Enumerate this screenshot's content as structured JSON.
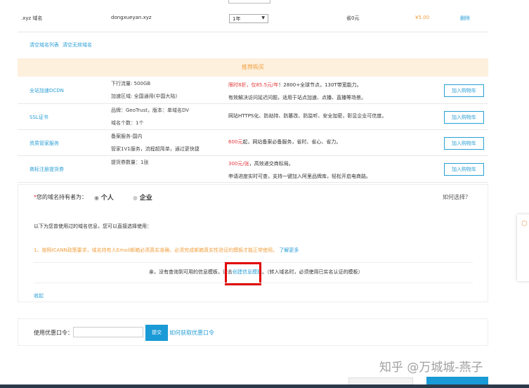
{
  "domain_row": {
    "type": ".xyz 域名",
    "name": "dongxueyan.xyz",
    "period": "1年",
    "discount": "省0元",
    "price": "¥5.00",
    "delete": "删除"
  },
  "list_links": [
    "清空域名列表",
    "清空无效域名"
  ],
  "recommend": {
    "title": "推荐购买",
    "add_label": "加入购物车",
    "items": [
      {
        "name": "全站加速DCDN",
        "spec": [
          "下行流量: 500GB",
          "加速区域: 全国通用(中国大陆)"
        ],
        "highlight": "限时8折，仅85.5元/年",
        "desc": [
          "！2800+全球节点，130T带宽能力。",
          "有效解决访问延迟问题，适用于站点加速、点播、直播等场景。"
        ]
      },
      {
        "name": "SSL证书",
        "spec": [
          "品牌：GeoTrust，版本：单域名DV",
          "域名个数：1个"
        ],
        "highlight": "",
        "desc": [
          "网站HTTPS化、防劫持、防篡改、防监听、安全加密，彰显企业可信度。",
          ""
        ]
      },
      {
        "name": "资质管家服务",
        "spec": [
          "备案服务-国内",
          "管家1V1服务，流程超简单，通过更快捷"
        ],
        "highlight": "600元",
        "desc": [
          "起，网站备案必备服务，省时、省心、省力。",
          ""
        ]
      },
      {
        "name": "商标注册提货券",
        "spec": [
          "提货券数量：1张",
          ""
        ],
        "highlight": "300元/张",
        "desc": [
          "，高效递交商标局。",
          "申请进度实时可查，支持一键加入阿里品牌库，轻松开启电商路。"
        ]
      }
    ]
  },
  "holder": {
    "required": "*",
    "label": "您的域名持有者为：",
    "options": [
      "个人",
      "企业"
    ],
    "selected": "个人",
    "help": "如何选择？",
    "intro": "以下为您曾使用过的域名信息，您可以直接选择使用：",
    "notice": "1、按照ICANN政策要求，域名持有人Email邮箱必须真实准确，必须完成邮箱真实性验证的模板才能正常使用。",
    "learn_more": "了解更多",
    "empty_prefix": "亲，没有查询到可用的信息模板，请去",
    "create_link": "创建信息模板",
    "empty_suffix": "。（转入域名时，必须使用已实名认证的模板）",
    "collapse": "收起"
  },
  "coupon": {
    "label": "使用优惠口令：",
    "value": "",
    "submit": "提交",
    "help": "如何获取优惠口令"
  },
  "watermark": "知乎 @万城城-燕子",
  "highlight_color": "#e00000",
  "accent": "#2a9fd6"
}
